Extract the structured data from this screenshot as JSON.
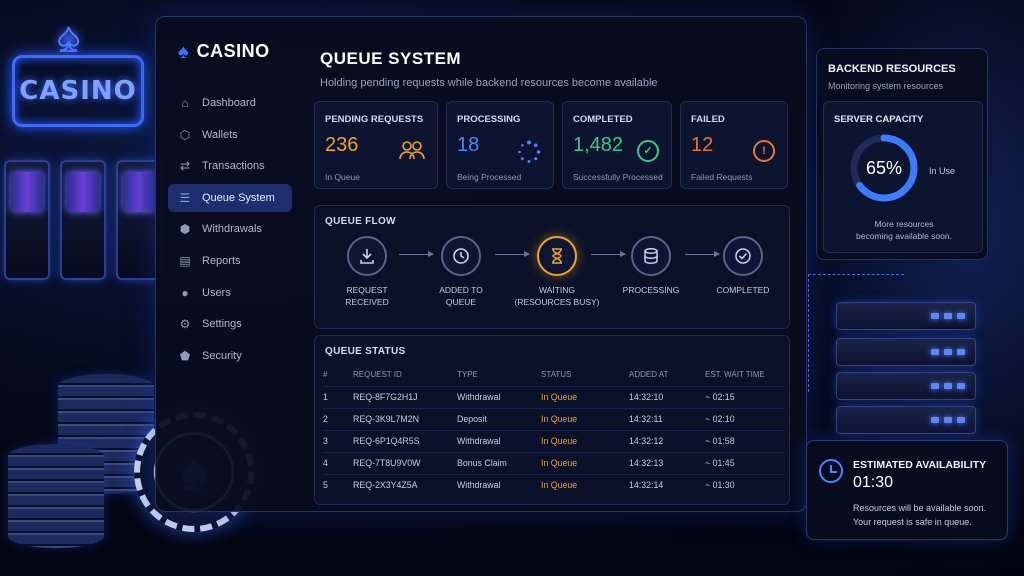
{
  "brand": {
    "name": "CASINO",
    "sign_text": "CASINO"
  },
  "sidebar": {
    "items": [
      {
        "label": "Dashboard",
        "icon": "home-icon",
        "active": false
      },
      {
        "label": "Wallets",
        "icon": "shield-icon",
        "active": false
      },
      {
        "label": "Transactions",
        "icon": "transactions-icon",
        "active": false
      },
      {
        "label": "Queue System",
        "icon": "queue-icon",
        "active": true
      },
      {
        "label": "Withdrawals",
        "icon": "withdrawals-icon",
        "active": false
      },
      {
        "label": "Reports",
        "icon": "reports-icon",
        "active": false
      },
      {
        "label": "Users",
        "icon": "user-icon",
        "active": false
      },
      {
        "label": "Settings",
        "icon": "gear-icon",
        "active": false
      },
      {
        "label": "Security",
        "icon": "security-icon",
        "active": false
      }
    ]
  },
  "page": {
    "title": "QUEUE SYSTEM",
    "subtitle": "Holding pending requests while backend resources become available"
  },
  "stats": {
    "pending": {
      "label": "PENDING REQUESTS",
      "value": "236",
      "sub": "In Queue",
      "color": "#f0a229",
      "icon": "users-icon"
    },
    "processing": {
      "label": "PROCESSING",
      "value": "18",
      "sub": "Being Processed",
      "color": "#4f83ff",
      "icon": "spinner-icon"
    },
    "completed": {
      "label": "COMPLETED",
      "value": "1,482",
      "sub": "Successfully Processed",
      "color": "#37c98b",
      "icon": "check-circle-icon"
    },
    "failed": {
      "label": "FAILED",
      "value": "12",
      "sub": "Failed Requests",
      "color": "#e8752f",
      "icon": "alert-icon"
    }
  },
  "flow": {
    "title": "QUEUE FLOW",
    "steps": [
      {
        "line1": "REQUEST",
        "line2": "RECEIVED",
        "icon": "download-icon"
      },
      {
        "line1": "ADDED TO",
        "line2": "QUEUE",
        "icon": "clock-icon"
      },
      {
        "line1": "WAITING",
        "line2": "(RESOURCES BUSY)",
        "icon": "hourglass-icon"
      },
      {
        "line1": "PROCESSING",
        "line2": "",
        "icon": "database-icon"
      },
      {
        "line1": "COMPLETED",
        "line2": "",
        "icon": "check-circle-icon"
      }
    ]
  },
  "queue_status": {
    "title": "QUEUE STATUS",
    "columns": [
      "#",
      "REQUEST ID",
      "TYPE",
      "STATUS",
      "ADDED AT",
      "EST. WAIT TIME"
    ],
    "rows": [
      [
        "1",
        "REQ-8F7G2H1J",
        "Withdrawal",
        "In Queue",
        "14:32:10",
        "~ 02:15"
      ],
      [
        "2",
        "REQ-3K9L7M2N",
        "Deposit",
        "In Queue",
        "14:32:11",
        "~ 02:10"
      ],
      [
        "3",
        "REQ-6P1Q4R5S",
        "Withdrawal",
        "In Queue",
        "14:32:12",
        "~ 01:58"
      ],
      [
        "4",
        "REQ-7T8U9V0W",
        "Bonus Claim",
        "In Queue",
        "14:32:13",
        "~ 01:45"
      ],
      [
        "5",
        "REQ-2X3Y4Z5A",
        "Withdrawal",
        "In Queue",
        "14:32:14",
        "~ 01:30"
      ]
    ],
    "status_color": "#f0a229"
  },
  "backend": {
    "title": "BACKEND RESOURCES",
    "subtitle": "Monitoring system resources",
    "capacity_title": "SERVER CAPACITY",
    "capacity_value": "65%",
    "capacity_fraction": 0.65,
    "capacity_unit": "In Use",
    "note_line1": "More resources",
    "note_line2": "becoming available soon."
  },
  "availability": {
    "title": "ESTIMATED AVAILABILITY",
    "time": "01:30",
    "message_line1": "Resources will be available soon.",
    "message_line2": "Your request is safe in queue."
  },
  "colors": {
    "accent": "#2f5cff",
    "warning": "#f0a229",
    "success": "#37c98b",
    "danger": "#e8752f"
  }
}
